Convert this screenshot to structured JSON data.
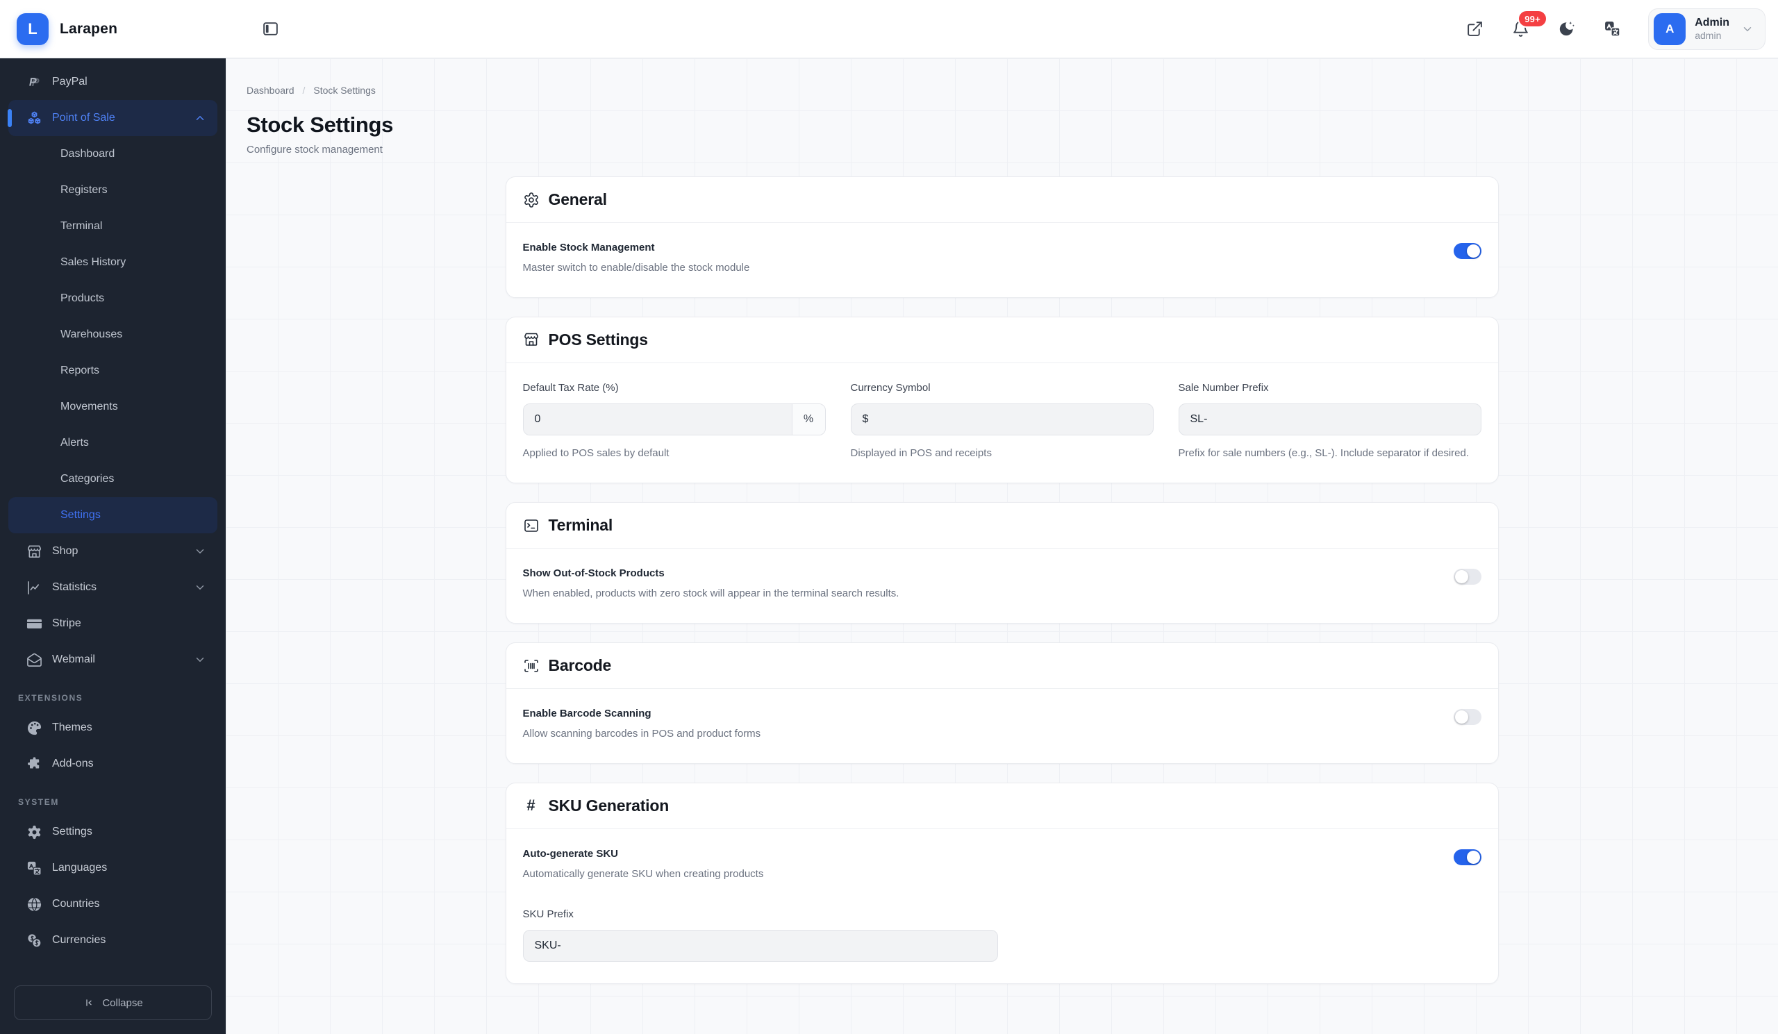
{
  "brand": {
    "name": "Larapen",
    "logo_letter": "L"
  },
  "topbar": {
    "notification_count": "99+",
    "user": {
      "name": "Admin",
      "role": "admin",
      "initial": "A"
    }
  },
  "sidebar": {
    "paypal": {
      "label": "PayPal",
      "icon": "paypal-icon"
    },
    "pos": {
      "label": "Point of Sale",
      "icon": "boxes-icon",
      "expanded": true,
      "active": true
    },
    "pos_children": [
      "Dashboard",
      "Registers",
      "Terminal",
      "Sales History",
      "Products",
      "Warehouses",
      "Reports",
      "Movements",
      "Alerts",
      "Categories",
      "Settings"
    ],
    "pos_active_child": "Settings",
    "shop": {
      "label": "Shop",
      "icon": "store-icon"
    },
    "statistics": {
      "label": "Statistics",
      "icon": "line-chart-icon"
    },
    "stripe": {
      "label": "Stripe",
      "icon": "credit-card-icon"
    },
    "webmail": {
      "label": "Webmail",
      "icon": "mail-icon"
    },
    "section_extensions": "EXTENSIONS",
    "section_system": "SYSTEM",
    "themes": {
      "label": "Themes",
      "icon": "palette-icon"
    },
    "addons": {
      "label": "Add-ons",
      "icon": "puzzle-icon"
    },
    "settings": {
      "label": "Settings",
      "icon": "gear-icon"
    },
    "languages": {
      "label": "Languages",
      "icon": "translate-icon"
    },
    "countries": {
      "label": "Countries",
      "icon": "globe-icon"
    },
    "currencies": {
      "label": "Currencies",
      "icon": "coins-icon"
    },
    "collapse_label": "Collapse"
  },
  "breadcrumb": {
    "parent": "Dashboard",
    "separator": "/",
    "current": "Stock Settings"
  },
  "page": {
    "title": "Stock Settings",
    "subtitle": "Configure stock management"
  },
  "cards": {
    "general": {
      "title": "General",
      "icon": "gear-icon",
      "setting_label": "Enable Stock Management",
      "setting_help": "Master switch to enable/disable the stock module",
      "enabled": true
    },
    "pos_settings": {
      "title": "POS Settings",
      "icon": "store-icon",
      "fields": [
        {
          "label": "Default Tax Rate (%)",
          "value": "0",
          "suffix": "%",
          "help": "Applied to POS sales by default"
        },
        {
          "label": "Currency Symbol",
          "value": "$",
          "help": "Displayed in POS and receipts"
        },
        {
          "label": "Sale Number Prefix",
          "value": "SL-",
          "help": "Prefix for sale numbers (e.g., SL-). Include separator if desired."
        }
      ]
    },
    "terminal": {
      "title": "Terminal",
      "icon": "terminal-icon",
      "setting_label": "Show Out-of-Stock Products",
      "setting_help": "When enabled, products with zero stock will appear in the terminal search results.",
      "enabled": false
    },
    "barcode": {
      "title": "Barcode",
      "icon": "barcode-scan-icon",
      "setting_label": "Enable Barcode Scanning",
      "setting_help": "Allow scanning barcodes in POS and product forms",
      "enabled": false
    },
    "sku": {
      "title": "SKU Generation",
      "icon": "hash-icon",
      "setting_label": "Auto-generate SKU",
      "setting_help": "Automatically generate SKU when creating products",
      "enabled": true,
      "prefix_label": "SKU Prefix",
      "prefix_value": "SKU-"
    }
  },
  "colors": {
    "accent_blue": "#2563eb",
    "avatar_blue": "#2b6cf0",
    "sidebar_bg": "#1d2430",
    "sidebar_active_bg": "#1d2a47",
    "active_text_blue": "#4f82f6",
    "badge_red": "#f43f42",
    "content_bg": "#f8f9fb"
  }
}
